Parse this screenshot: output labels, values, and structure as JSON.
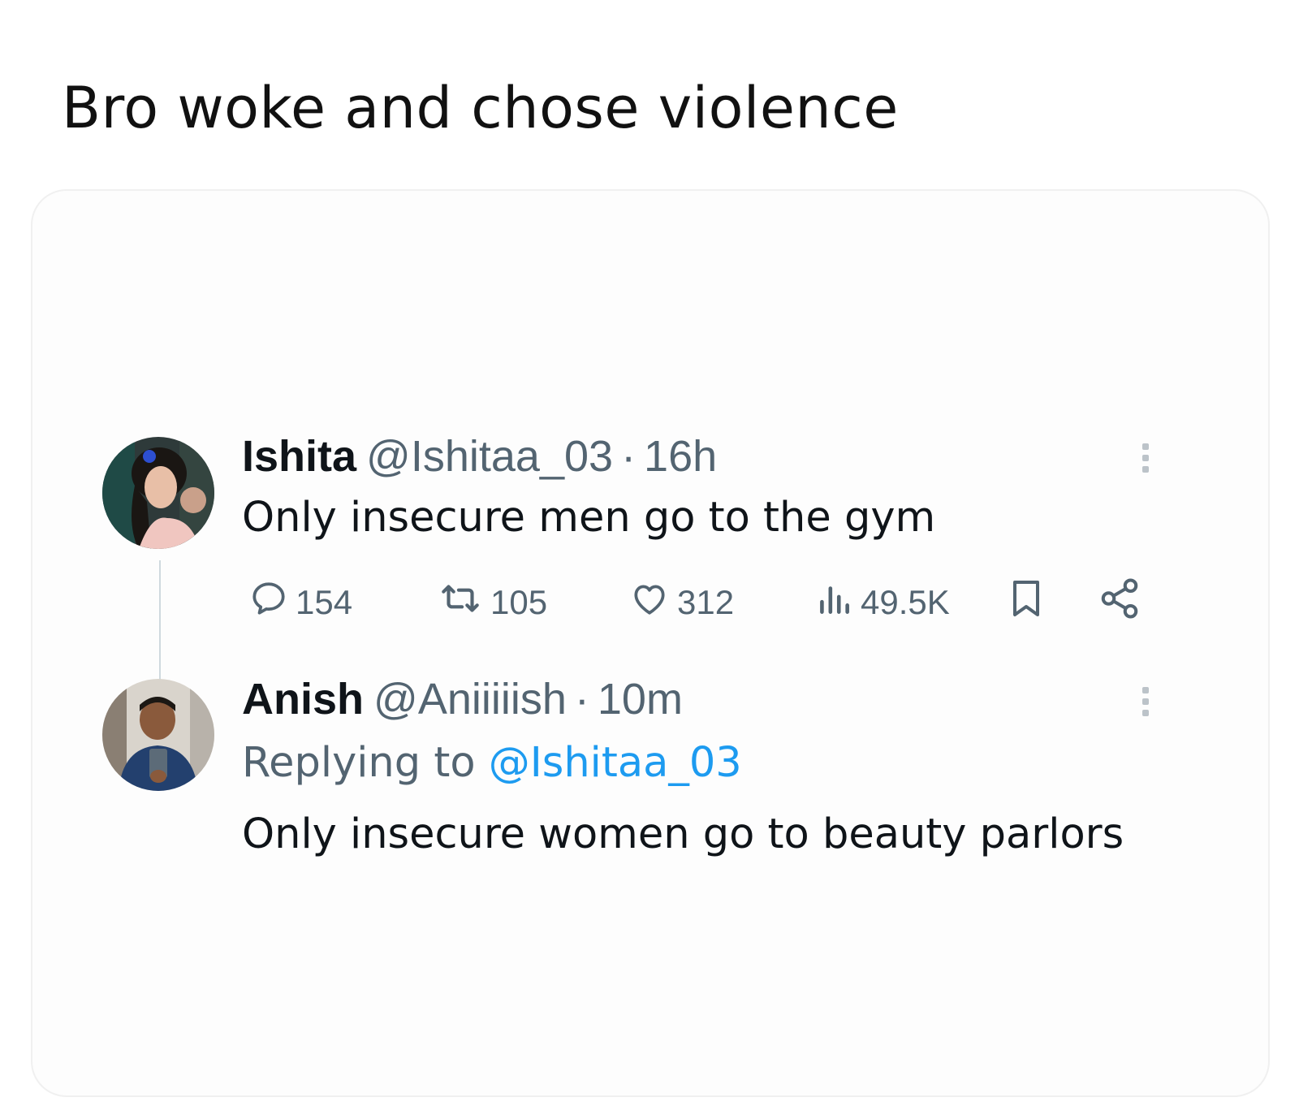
{
  "caption": "Bro woke and chose violence",
  "tweets": [
    {
      "name": "Ishita",
      "handle": "@Ishitaa_03",
      "separator": "·",
      "time": "16h",
      "text": "Only insecure men go to the gym",
      "actions": {
        "replies": "154",
        "reposts": "105",
        "likes": "312",
        "views": "49.5K"
      }
    },
    {
      "name": "Anish",
      "handle": "@Aniiiiish",
      "separator": "·",
      "time": "10m",
      "replying_prefix": "Replying to",
      "replying_to": "@Ishitaa_03",
      "text": "Only insecure women go to beauty parlors"
    }
  ],
  "icons": {
    "reply": "reply-icon",
    "repost": "repost-icon",
    "like": "heart-icon",
    "views": "views-icon",
    "bookmark": "bookmark-icon",
    "share": "share-icon",
    "more": "more-icon"
  },
  "colors": {
    "text": "#0f1419",
    "secondary": "#536471",
    "mention": "#1d9bf0"
  }
}
